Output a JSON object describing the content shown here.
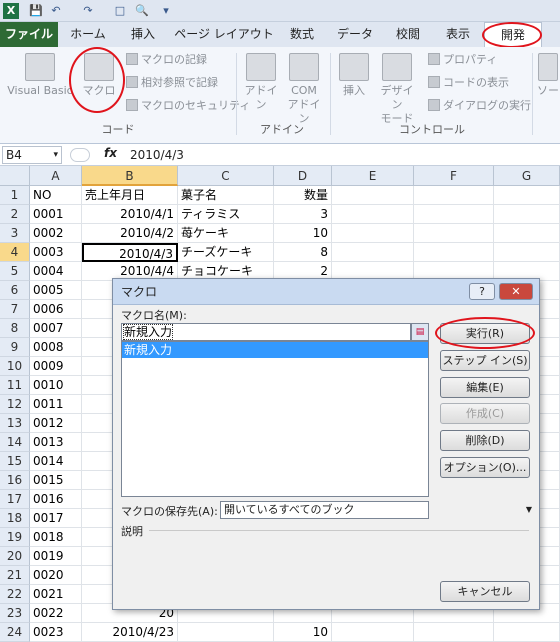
{
  "qat": {
    "save": "💾",
    "undo": "↶",
    "redo": "↷",
    "new": "□",
    "preview": "🔍",
    "more": "▾"
  },
  "tabs": [
    "ファイル",
    "ホーム",
    "挿入",
    "ページ レイアウト",
    "数式",
    "データ",
    "校閲",
    "表示",
    "開発"
  ],
  "ribbon": {
    "code": {
      "name": "コード",
      "visual_basic": "Visual Basic",
      "macro": "マクロ",
      "record": "マクロの記録",
      "relative": "相対参照で記録",
      "security": "マクロのセキュリティ"
    },
    "addin": {
      "name": "アドイン",
      "addin": "アドイン",
      "com1": "COM",
      "com2": "アドイン"
    },
    "controls": {
      "name": "コントロール",
      "insert": "挿入",
      "design1": "デザイン",
      "design2": "モード",
      "properties": "プロパティ",
      "view_code": "コードの表示",
      "dialog": "ダイアログの実行",
      "partial": "ソー"
    }
  },
  "formula_bar": {
    "cell_ref": "B4",
    "dropdown": "▾",
    "fx": "fx",
    "value": "2010/4/3"
  },
  "grid": {
    "columns": [
      "A",
      "B",
      "C",
      "D",
      "E",
      "F",
      "G"
    ],
    "rows": [
      {
        "num": "1",
        "a": "NO",
        "b": "売上年月日",
        "c": "菓子名",
        "d": "数量"
      },
      {
        "num": "2",
        "a": "0001",
        "b": "2010/4/1",
        "c": "ティラミス",
        "d": "3"
      },
      {
        "num": "3",
        "a": "0002",
        "b": "2010/4/2",
        "c": "苺ケーキ",
        "d": "10"
      },
      {
        "num": "4",
        "a": "0003",
        "b": "2010/4/3",
        "c": "チーズケーキ",
        "d": "8"
      },
      {
        "num": "5",
        "a": "0004",
        "b": "2010/4/4",
        "c": "チョコケーキ",
        "d": "2"
      },
      {
        "num": "6",
        "a": "0005",
        "b": "",
        "c": "",
        "d": ""
      },
      {
        "num": "7",
        "a": "0006",
        "b": "",
        "c": "",
        "d": ""
      },
      {
        "num": "8",
        "a": "0007",
        "b": "",
        "c": "",
        "d": ""
      },
      {
        "num": "9",
        "a": "0008",
        "b": "",
        "c": "",
        "d": ""
      },
      {
        "num": "10",
        "a": "0009",
        "b": "",
        "c": "",
        "d": ""
      },
      {
        "num": "11",
        "a": "0010",
        "b": "20",
        "c": "",
        "d": ""
      },
      {
        "num": "12",
        "a": "0011",
        "b": "20",
        "c": "",
        "d": ""
      },
      {
        "num": "13",
        "a": "0012",
        "b": "20",
        "c": "",
        "d": ""
      },
      {
        "num": "14",
        "a": "0013",
        "b": "20",
        "c": "",
        "d": ""
      },
      {
        "num": "15",
        "a": "0014",
        "b": "20",
        "c": "",
        "d": ""
      },
      {
        "num": "16",
        "a": "0015",
        "b": "20",
        "c": "",
        "d": ""
      },
      {
        "num": "17",
        "a": "0016",
        "b": "20",
        "c": "",
        "d": ""
      },
      {
        "num": "18",
        "a": "0017",
        "b": "20",
        "c": "",
        "d": ""
      },
      {
        "num": "19",
        "a": "0018",
        "b": "20",
        "c": "",
        "d": ""
      },
      {
        "num": "20",
        "a": "0019",
        "b": "20",
        "c": "",
        "d": ""
      },
      {
        "num": "21",
        "a": "0020",
        "b": "20",
        "c": "",
        "d": ""
      },
      {
        "num": "22",
        "a": "0021",
        "b": "20",
        "c": "",
        "d": ""
      },
      {
        "num": "23",
        "a": "0022",
        "b": "20",
        "c": "",
        "d": ""
      },
      {
        "num": "24",
        "a": "0023",
        "b": "2010/4/23",
        "c": "",
        "d": "10"
      }
    ]
  },
  "dialog": {
    "title": "マクロ",
    "help": "?",
    "close": "✕",
    "macro_name_label": "マクロ名(M):",
    "macro_name_value": "新規入力",
    "list_items": [
      "新規入力"
    ],
    "buttons": {
      "run": "実行(R)",
      "step_in": "ステップ イン(S)",
      "edit": "編集(E)",
      "create": "作成(C)",
      "delete": "削除(D)",
      "options": "オプション(O)...",
      "cancel": "キャンセル"
    },
    "store_label": "マクロの保存先(A):",
    "store_value": "開いているすべてのブック",
    "description_label": "説明"
  },
  "colors": {
    "highlight": "#e0141c",
    "file_tab": "#2e6a35",
    "selection": "#3399ff"
  }
}
